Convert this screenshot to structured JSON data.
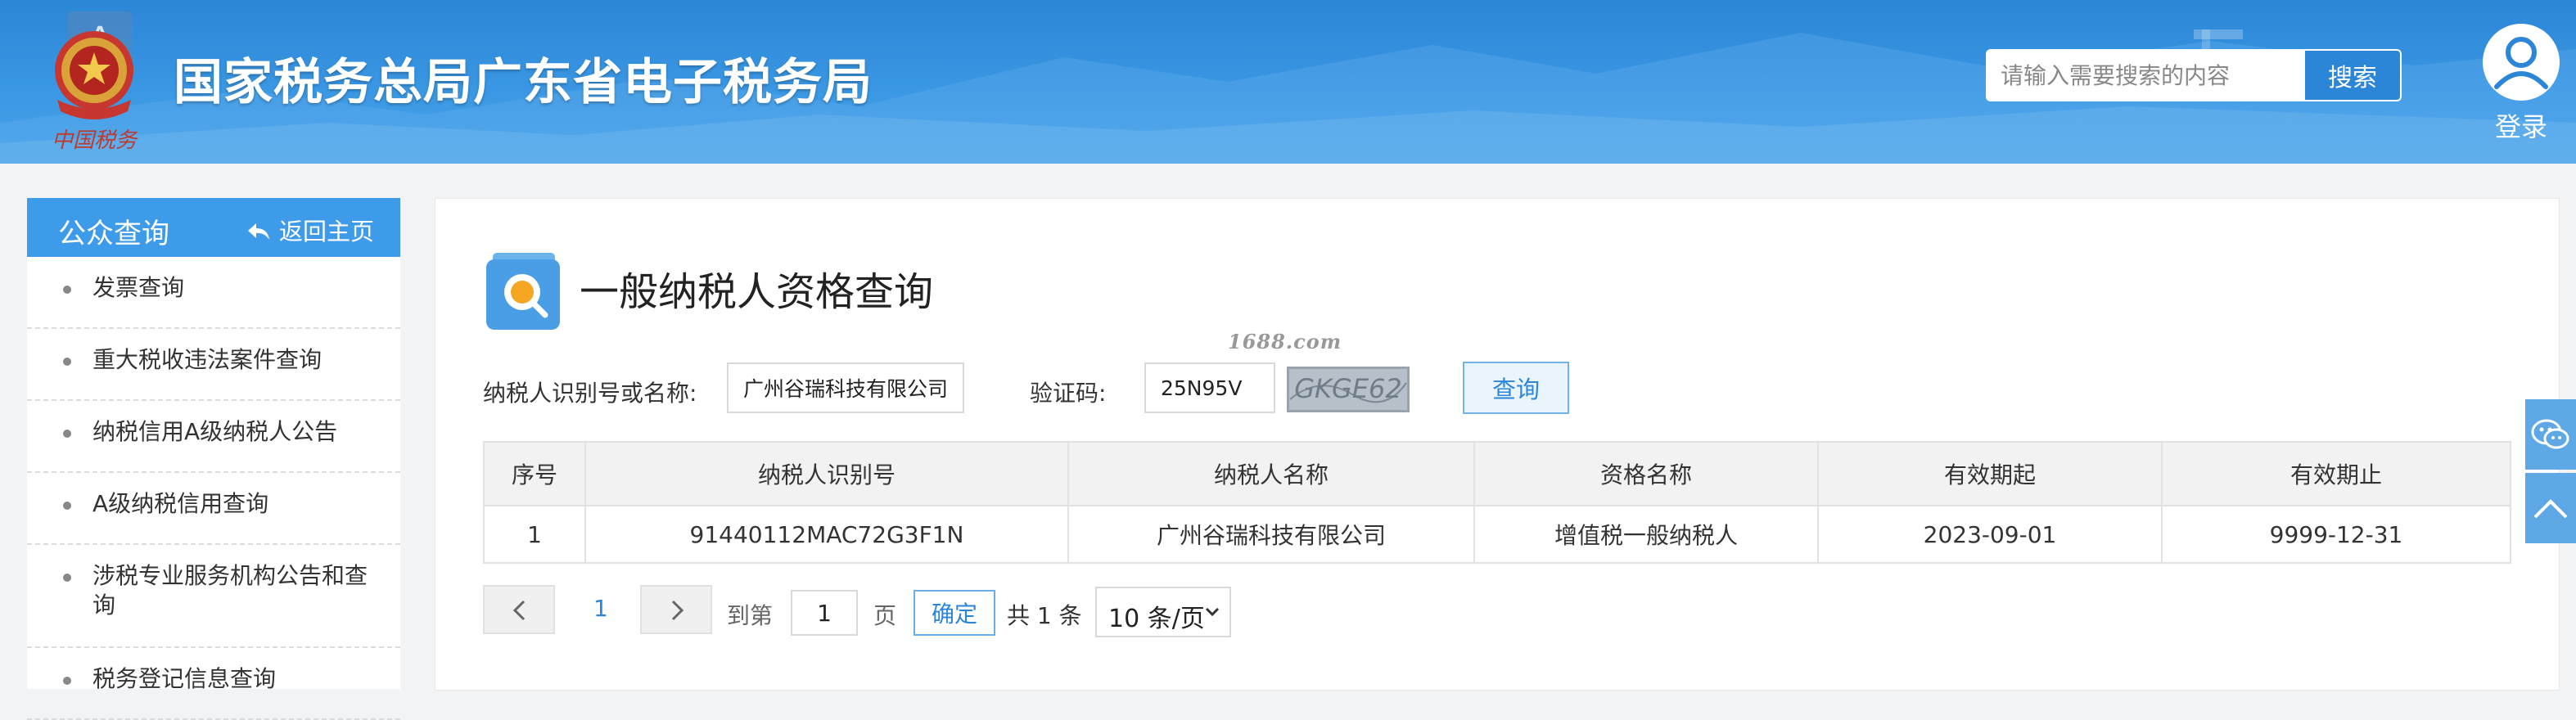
{
  "header": {
    "site_title": "国家税务总局广东省电子税务局",
    "emblem_text": "中国税务",
    "search_placeholder": "请输入需要搜索的内容",
    "search_button": "搜索",
    "login_label": "登录"
  },
  "sidebar": {
    "title": "公众查询",
    "back_home": "返回主页",
    "items": [
      {
        "label": "发票查询"
      },
      {
        "label": "重大税收违法案件查询"
      },
      {
        "label": "纳税信用A级纳税人公告"
      },
      {
        "label": "A级纳税信用查询"
      },
      {
        "label": "涉税专业服务机构公告和查询"
      },
      {
        "label": "税务登记信息查询"
      }
    ]
  },
  "main": {
    "page_title": "一般纳税人资格查询",
    "taxpayer_label": "纳税人识别号或名称:",
    "taxpayer_value": "广州谷瑞科技有限公司",
    "captcha_label": "验证码:",
    "captcha_value": "25N95V",
    "captcha_image_text": "GKGE62",
    "query_button": "查询",
    "watermark": "1688.com",
    "table": {
      "headers": [
        "序号",
        "纳税人识别号",
        "纳税人名称",
        "资格名称",
        "有效期起",
        "有效期止"
      ],
      "rows": [
        [
          "1",
          "91440112MAC72G3F1N",
          "广州谷瑞科技有限公司",
          "增值税一般纳税人",
          "2023-09-01",
          "9999-12-31"
        ]
      ]
    },
    "pagination": {
      "current_page": "1",
      "goto_prefix": "到第",
      "goto_value": "1",
      "goto_suffix": "页",
      "confirm": "确定",
      "total": "共 1 条",
      "page_size": "10 条/页"
    }
  },
  "colors": {
    "header_blue": "#2c86d6",
    "sidebar_head": "#3d9bea",
    "link_blue": "#2b86d8"
  },
  "icons": [
    "emblem-icon",
    "user-avatar-icon",
    "back-arrow-icon",
    "search-doc-icon",
    "chevron-left-icon",
    "chevron-right-icon",
    "chevron-down-icon",
    "wechat-icon",
    "back-to-top-icon"
  ]
}
